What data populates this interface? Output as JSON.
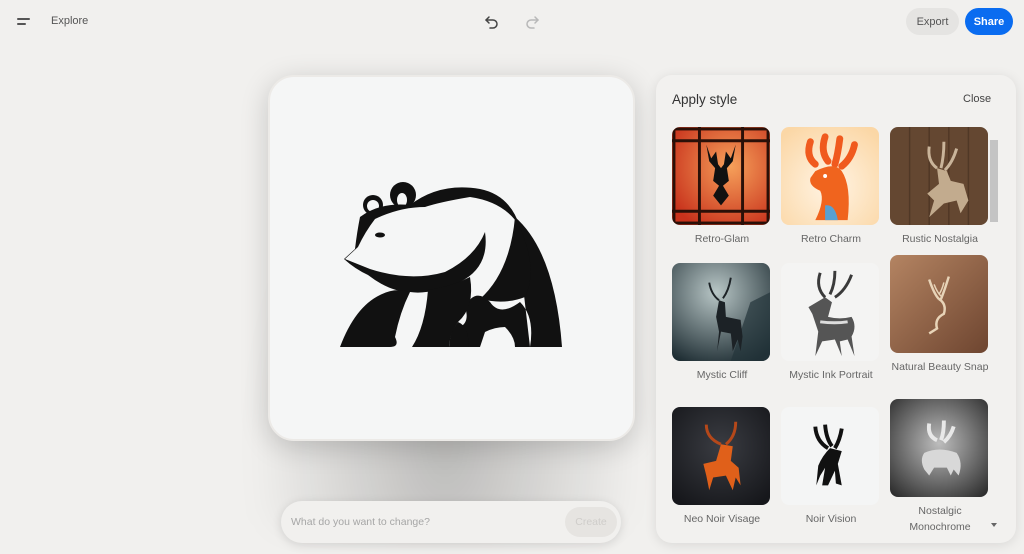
{
  "topbar": {
    "menu_icon": "hamburger-menu-icon",
    "explore_label": "Explore",
    "undo_icon": "undo-icon",
    "redo_icon": "redo-icon",
    "export_label": "Export",
    "share_label": "Share",
    "share_color": "#0a6cf0"
  },
  "canvas": {
    "image": "black-and-white bear logo"
  },
  "prompt": {
    "placeholder": "What do you want to change?",
    "value": "",
    "create_label": "Create"
  },
  "panel": {
    "title": "Apply style",
    "close_label": "Close",
    "styles": [
      {
        "label": "Retro-Glam",
        "thumb": "stained-glass deer head on orange"
      },
      {
        "label": "Retro Charm",
        "thumb": "orange cartoon deer on cream"
      },
      {
        "label": "Rustic Nostalgia",
        "thumb": "metal deer on wooden planks"
      },
      {
        "label": "Mystic Cliff",
        "thumb": "dark deer silhouette on misty cliff"
      },
      {
        "label": "Mystic Ink Portrait",
        "thumb": "ink-drawn deer on white"
      },
      {
        "label": "Natural Beauty Snap",
        "thumb": "embossed deer on brown leather"
      },
      {
        "label": "Neo Noir Visage",
        "thumb": "orange glossy deer on black"
      },
      {
        "label": "Noir Vision",
        "thumb": "black deer logo on white"
      },
      {
        "label": "Nostalgic Monochrome",
        "thumb": "embossed grey deer"
      }
    ]
  }
}
